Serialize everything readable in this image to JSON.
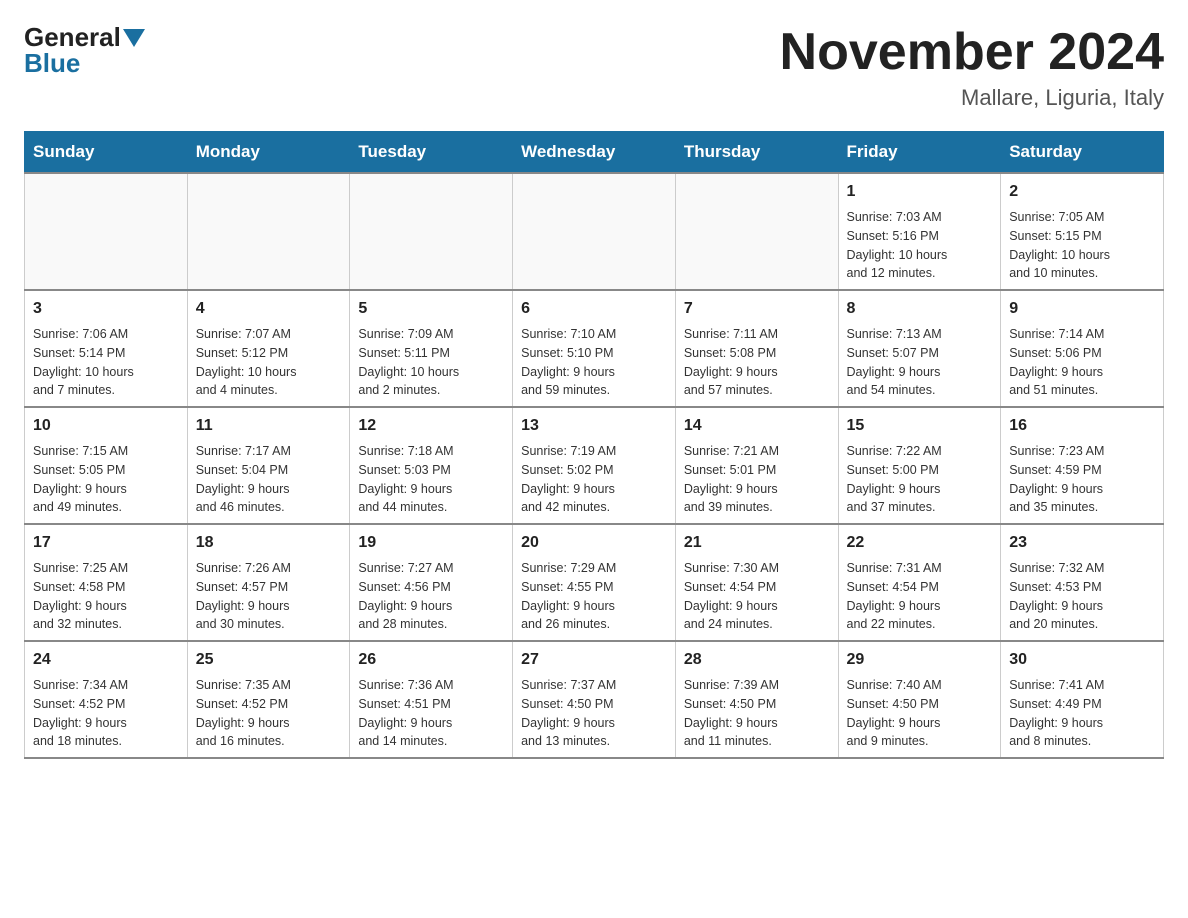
{
  "header": {
    "logo_general": "General",
    "logo_blue": "Blue",
    "month_title": "November 2024",
    "location": "Mallare, Liguria, Italy"
  },
  "weekdays": [
    "Sunday",
    "Monday",
    "Tuesday",
    "Wednesday",
    "Thursday",
    "Friday",
    "Saturday"
  ],
  "weeks": [
    [
      {
        "day": "",
        "info": ""
      },
      {
        "day": "",
        "info": ""
      },
      {
        "day": "",
        "info": ""
      },
      {
        "day": "",
        "info": ""
      },
      {
        "day": "",
        "info": ""
      },
      {
        "day": "1",
        "info": "Sunrise: 7:03 AM\nSunset: 5:16 PM\nDaylight: 10 hours\nand 12 minutes."
      },
      {
        "day": "2",
        "info": "Sunrise: 7:05 AM\nSunset: 5:15 PM\nDaylight: 10 hours\nand 10 minutes."
      }
    ],
    [
      {
        "day": "3",
        "info": "Sunrise: 7:06 AM\nSunset: 5:14 PM\nDaylight: 10 hours\nand 7 minutes."
      },
      {
        "day": "4",
        "info": "Sunrise: 7:07 AM\nSunset: 5:12 PM\nDaylight: 10 hours\nand 4 minutes."
      },
      {
        "day": "5",
        "info": "Sunrise: 7:09 AM\nSunset: 5:11 PM\nDaylight: 10 hours\nand 2 minutes."
      },
      {
        "day": "6",
        "info": "Sunrise: 7:10 AM\nSunset: 5:10 PM\nDaylight: 9 hours\nand 59 minutes."
      },
      {
        "day": "7",
        "info": "Sunrise: 7:11 AM\nSunset: 5:08 PM\nDaylight: 9 hours\nand 57 minutes."
      },
      {
        "day": "8",
        "info": "Sunrise: 7:13 AM\nSunset: 5:07 PM\nDaylight: 9 hours\nand 54 minutes."
      },
      {
        "day": "9",
        "info": "Sunrise: 7:14 AM\nSunset: 5:06 PM\nDaylight: 9 hours\nand 51 minutes."
      }
    ],
    [
      {
        "day": "10",
        "info": "Sunrise: 7:15 AM\nSunset: 5:05 PM\nDaylight: 9 hours\nand 49 minutes."
      },
      {
        "day": "11",
        "info": "Sunrise: 7:17 AM\nSunset: 5:04 PM\nDaylight: 9 hours\nand 46 minutes."
      },
      {
        "day": "12",
        "info": "Sunrise: 7:18 AM\nSunset: 5:03 PM\nDaylight: 9 hours\nand 44 minutes."
      },
      {
        "day": "13",
        "info": "Sunrise: 7:19 AM\nSunset: 5:02 PM\nDaylight: 9 hours\nand 42 minutes."
      },
      {
        "day": "14",
        "info": "Sunrise: 7:21 AM\nSunset: 5:01 PM\nDaylight: 9 hours\nand 39 minutes."
      },
      {
        "day": "15",
        "info": "Sunrise: 7:22 AM\nSunset: 5:00 PM\nDaylight: 9 hours\nand 37 minutes."
      },
      {
        "day": "16",
        "info": "Sunrise: 7:23 AM\nSunset: 4:59 PM\nDaylight: 9 hours\nand 35 minutes."
      }
    ],
    [
      {
        "day": "17",
        "info": "Sunrise: 7:25 AM\nSunset: 4:58 PM\nDaylight: 9 hours\nand 32 minutes."
      },
      {
        "day": "18",
        "info": "Sunrise: 7:26 AM\nSunset: 4:57 PM\nDaylight: 9 hours\nand 30 minutes."
      },
      {
        "day": "19",
        "info": "Sunrise: 7:27 AM\nSunset: 4:56 PM\nDaylight: 9 hours\nand 28 minutes."
      },
      {
        "day": "20",
        "info": "Sunrise: 7:29 AM\nSunset: 4:55 PM\nDaylight: 9 hours\nand 26 minutes."
      },
      {
        "day": "21",
        "info": "Sunrise: 7:30 AM\nSunset: 4:54 PM\nDaylight: 9 hours\nand 24 minutes."
      },
      {
        "day": "22",
        "info": "Sunrise: 7:31 AM\nSunset: 4:54 PM\nDaylight: 9 hours\nand 22 minutes."
      },
      {
        "day": "23",
        "info": "Sunrise: 7:32 AM\nSunset: 4:53 PM\nDaylight: 9 hours\nand 20 minutes."
      }
    ],
    [
      {
        "day": "24",
        "info": "Sunrise: 7:34 AM\nSunset: 4:52 PM\nDaylight: 9 hours\nand 18 minutes."
      },
      {
        "day": "25",
        "info": "Sunrise: 7:35 AM\nSunset: 4:52 PM\nDaylight: 9 hours\nand 16 minutes."
      },
      {
        "day": "26",
        "info": "Sunrise: 7:36 AM\nSunset: 4:51 PM\nDaylight: 9 hours\nand 14 minutes."
      },
      {
        "day": "27",
        "info": "Sunrise: 7:37 AM\nSunset: 4:50 PM\nDaylight: 9 hours\nand 13 minutes."
      },
      {
        "day": "28",
        "info": "Sunrise: 7:39 AM\nSunset: 4:50 PM\nDaylight: 9 hours\nand 11 minutes."
      },
      {
        "day": "29",
        "info": "Sunrise: 7:40 AM\nSunset: 4:50 PM\nDaylight: 9 hours\nand 9 minutes."
      },
      {
        "day": "30",
        "info": "Sunrise: 7:41 AM\nSunset: 4:49 PM\nDaylight: 9 hours\nand 8 minutes."
      }
    ]
  ]
}
